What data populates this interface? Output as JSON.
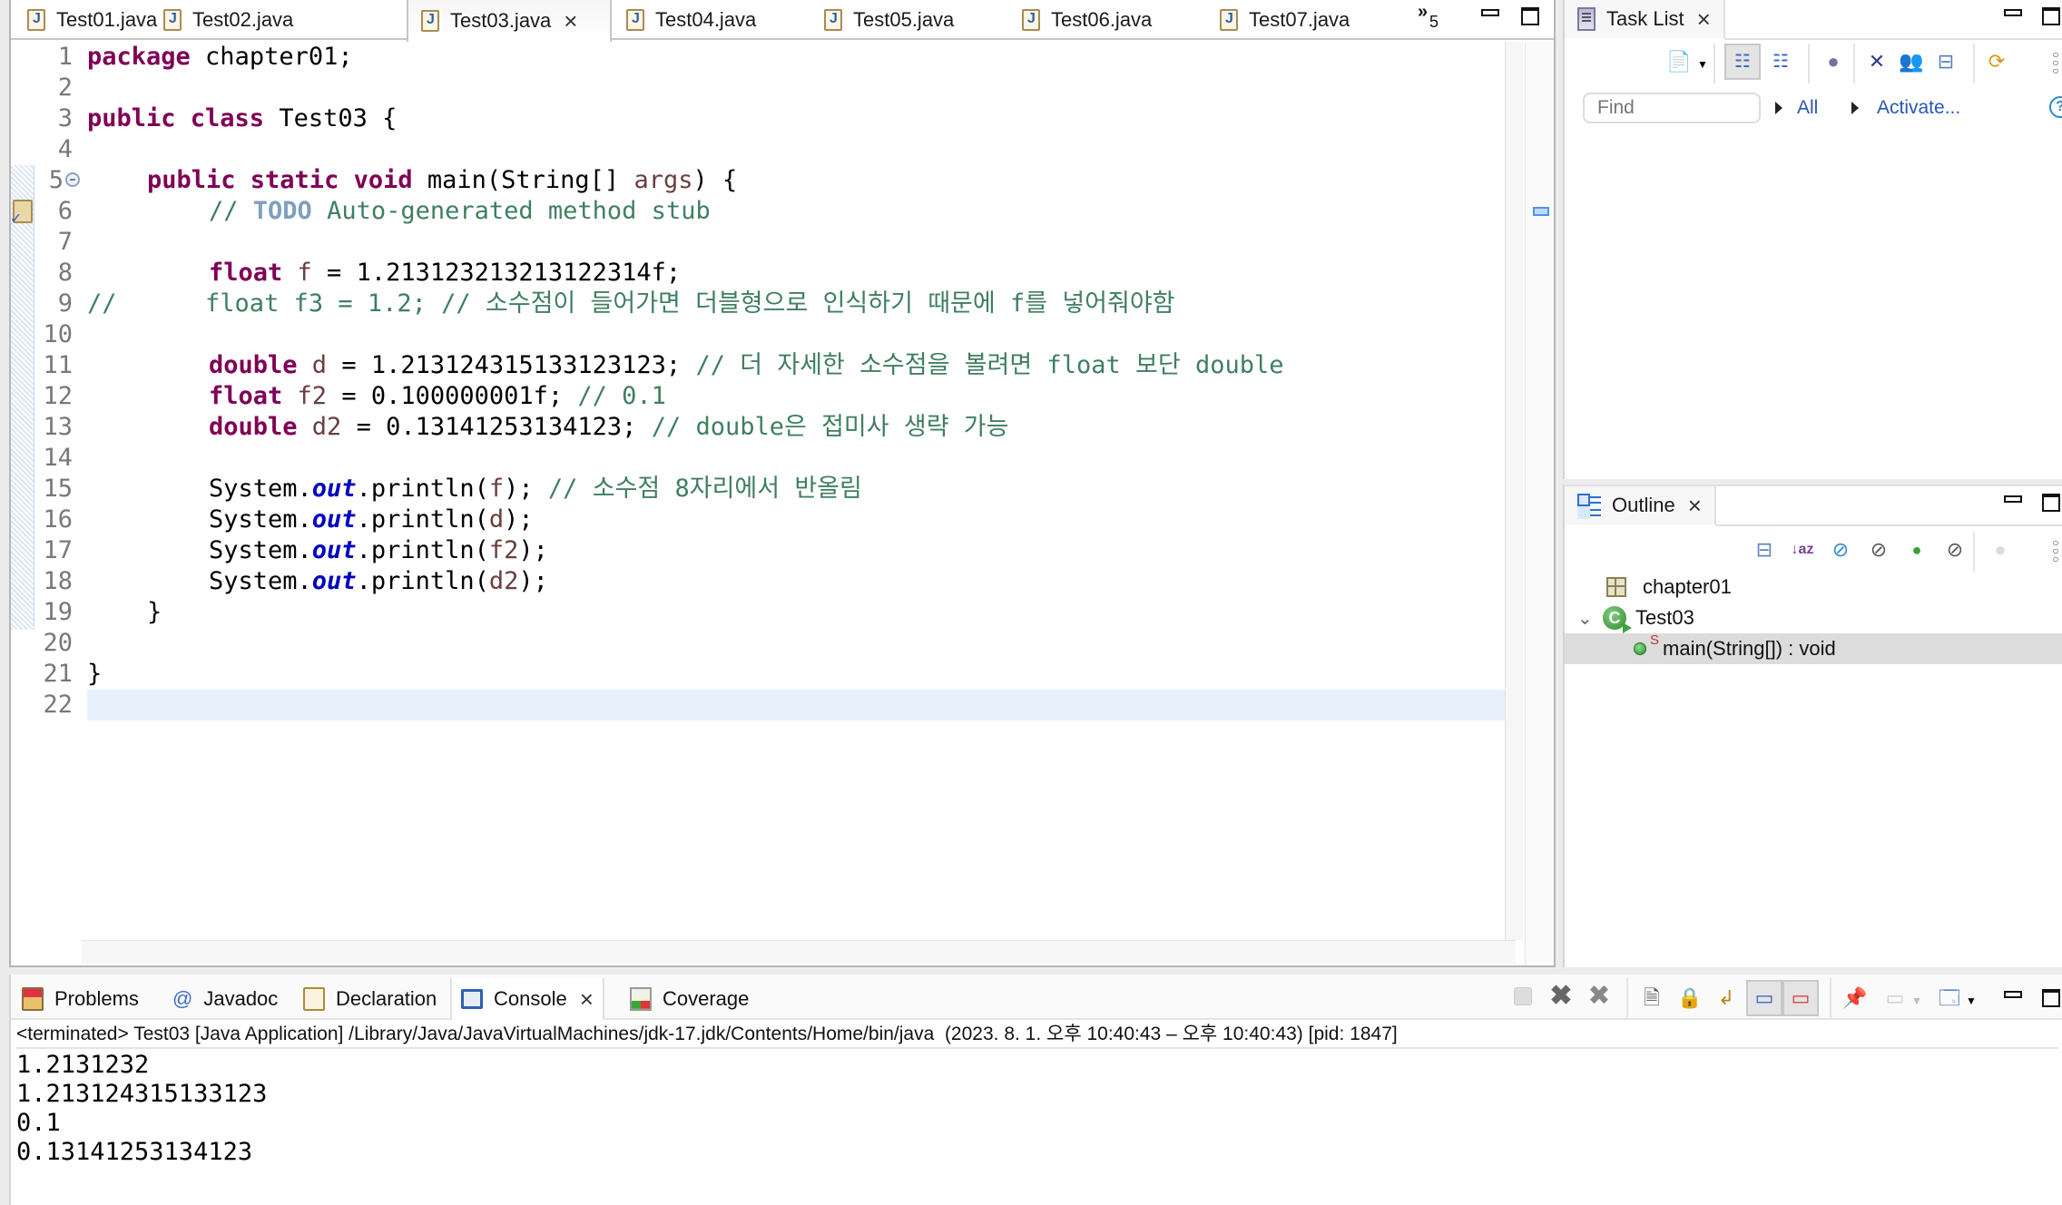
{
  "editor": {
    "tabs": [
      {
        "label": "Test01.java",
        "active": false
      },
      {
        "label": "Test02.java",
        "active": false
      },
      {
        "label": "Test03.java",
        "active": true
      },
      {
        "label": "Test04.java",
        "active": false
      },
      {
        "label": "Test05.java",
        "active": false
      },
      {
        "label": "Test06.java",
        "active": false
      },
      {
        "label": "Test07.java",
        "active": false
      }
    ],
    "hidden_tabs_count": "5",
    "close_glyph": "×",
    "line_numbers": [
      "1",
      "2",
      "3",
      "4",
      "5",
      "6",
      "7",
      "8",
      "9",
      "10",
      "11",
      "12",
      "13",
      "14",
      "15",
      "16",
      "17",
      "18",
      "19",
      "20",
      "21",
      "22"
    ],
    "code": {
      "l1_kw": "package",
      "l1_rest": " chapter01;",
      "l3_kw": "public class",
      "l3_rest": " Test03 {",
      "l5_kw": "public static void",
      "l5_a": " main(String[] ",
      "l5_var": "args",
      "l5_b": ") {",
      "l6_cm1": "// ",
      "l6_todo": "TODO",
      "l6_cm2": " Auto-generated method stub",
      "l8_kw": "float",
      "l8_var": " f",
      "l8_rest": " = 1.213123213213122314f;",
      "l9_cm": "//      float f3 = 1.2; // 소수점이 들어가면 더블형으로 인식하기 때문에 f를 넣어줘야함",
      "l11_kw": "double",
      "l11_var": " d",
      "l11_rest": " = 1.213124315133123123; ",
      "l11_cm": "// 더 자세한 소수점을 볼려면 float 보단 double",
      "l12_kw": "float",
      "l12_var": " f2",
      "l12_rest": " = 0.100000001f; ",
      "l12_cm": "// 0.1",
      "l13_kw": "double",
      "l13_var": " d2",
      "l13_rest": " = 0.13141253134123; ",
      "l13_cm": "// double은 접미사 생략 가능",
      "sys": "System.",
      "out": "out",
      "println": ".println(",
      "close": ");",
      "l15_var": "f",
      "l15_cm": " // 소수점 8자리에서 반올림",
      "l16_var": "d",
      "l17_var": "f2",
      "l18_var": "d2",
      "l19": "}",
      "l21": "}"
    }
  },
  "tasklist": {
    "title": "Task List",
    "find_placeholder": "Find",
    "filter_all": "All",
    "activate": "Activate...",
    "help": "?"
  },
  "outline": {
    "title": "Outline",
    "items": [
      {
        "label": "chapter01",
        "type": "package"
      },
      {
        "label": "Test03",
        "type": "class",
        "class_glyph": "C"
      },
      {
        "label": "main(String[]) : void",
        "type": "method",
        "modifier": "S"
      }
    ]
  },
  "bottom": {
    "tabs": [
      {
        "label": "Problems"
      },
      {
        "label": "Javadoc",
        "glyph": "@"
      },
      {
        "label": "Declaration"
      },
      {
        "label": "Console",
        "active": true
      },
      {
        "label": "Coverage"
      }
    ],
    "console_header": "<terminated> Test03 [Java Application] /Library/Java/JavaVirtualMachines/jdk-17.jdk/Contents/Home/bin/java  (2023. 8. 1. 오후 10:40:43 – 오후 10:40:43) [pid: 1847]",
    "output": [
      "1.2131232",
      "1.213124315133123",
      "0.1",
      "0.13141253134123"
    ]
  },
  "colors": {
    "keyword": "#7f0055",
    "comment": "#3f7f5f",
    "field": "#0000c0",
    "local_var": "#6a3e3e",
    "todo": "#7f9fbf",
    "link": "#2a56b8",
    "current_line": "#e8f0fb"
  }
}
